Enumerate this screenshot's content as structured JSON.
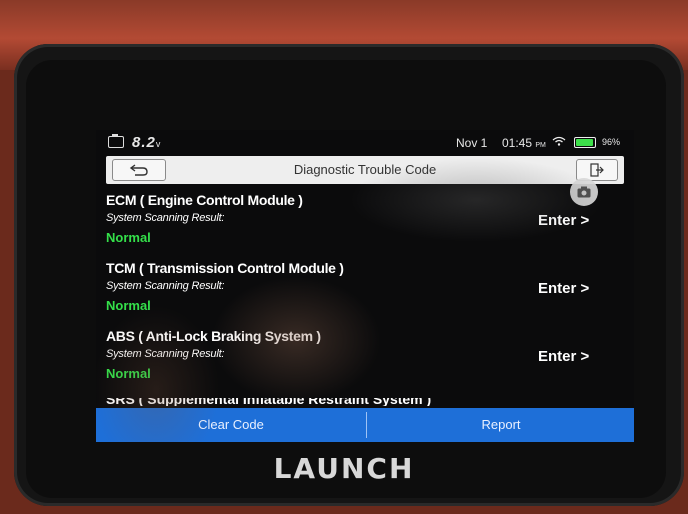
{
  "status_bar": {
    "voltage": "8.2",
    "voltage_unit": "v",
    "date": "Nov 1",
    "time": "01:45",
    "ampm": "PM",
    "battery_percent_text": "96%",
    "battery_level": 0.96
  },
  "header": {
    "title": "Diagnostic Trouble Code"
  },
  "modules": [
    {
      "name": "ECM ( Engine Control Module )",
      "scan_label": "System Scanning Result:",
      "result": "Normal",
      "action": "Enter >"
    },
    {
      "name": "TCM ( Transmission Control Module )",
      "scan_label": "System Scanning Result:",
      "result": "Normal",
      "action": "Enter >"
    },
    {
      "name": "ABS ( Anti-Lock Braking System )",
      "scan_label": "System Scanning Result:",
      "result": "Normal",
      "action": "Enter >"
    }
  ],
  "partial_module": "SRS ( Supplemental Inflatable Restraint System )",
  "footer": {
    "clear_label": "Clear Code",
    "report_label": "Report"
  },
  "brand": "LAUNCH",
  "colors": {
    "accent": "#1e6fd8",
    "status_normal": "#34e04a"
  }
}
